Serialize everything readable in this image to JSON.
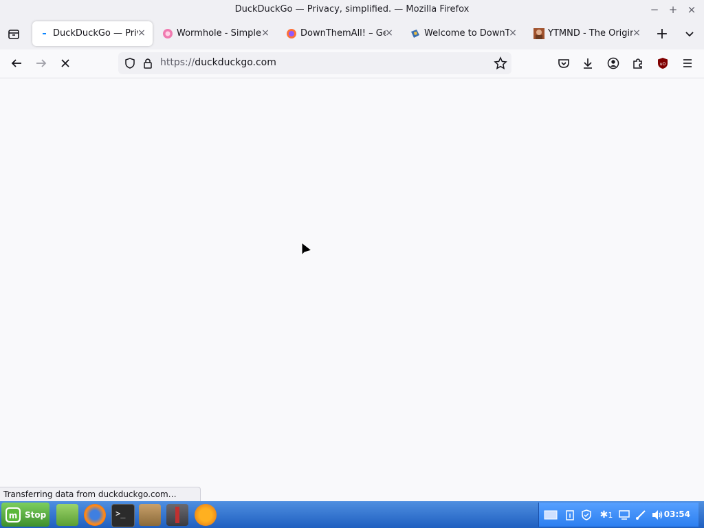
{
  "window": {
    "title": "DuckDuckGo — Privacy, simplified. — Mozilla Firefox",
    "minimize": "−",
    "maximize": "+",
    "close": "×"
  },
  "tabs": [
    {
      "label": "DuckDuckGo — Privacy, simplified.",
      "favicon": "duckduckgo-loading",
      "color": "#0a84ff",
      "active": true
    },
    {
      "label": "Wormhole - Simple, private file sharing",
      "favicon": "wormhole",
      "color": "#e84a8a",
      "active": false
    },
    {
      "label": "DownThemAll! – Get this Extension for Firefox",
      "favicon": "firefox",
      "color": "#ff7139",
      "active": false
    },
    {
      "label": "Welcome to DownThemAll!",
      "favicon": "downthemall",
      "color": "#3a6fb0",
      "active": false
    },
    {
      "label": "YTMND - The Original Meme Site",
      "favicon": "ytmnd",
      "color": "#a0522d",
      "active": false
    }
  ],
  "tab_close": "×",
  "new_tab": "+",
  "list_tabs": "⌄",
  "url": {
    "scheme": "https://",
    "host": "duckduckgo.com"
  },
  "status_text": "Transferring data from duckduckgo.com…",
  "taskbar": {
    "start_label": "Stop",
    "clock": "03:54",
    "notification_count": "1"
  },
  "colors": {
    "accent": "#0a84ff",
    "taskbar": "#2c6fd6",
    "ublock": "#800000"
  }
}
